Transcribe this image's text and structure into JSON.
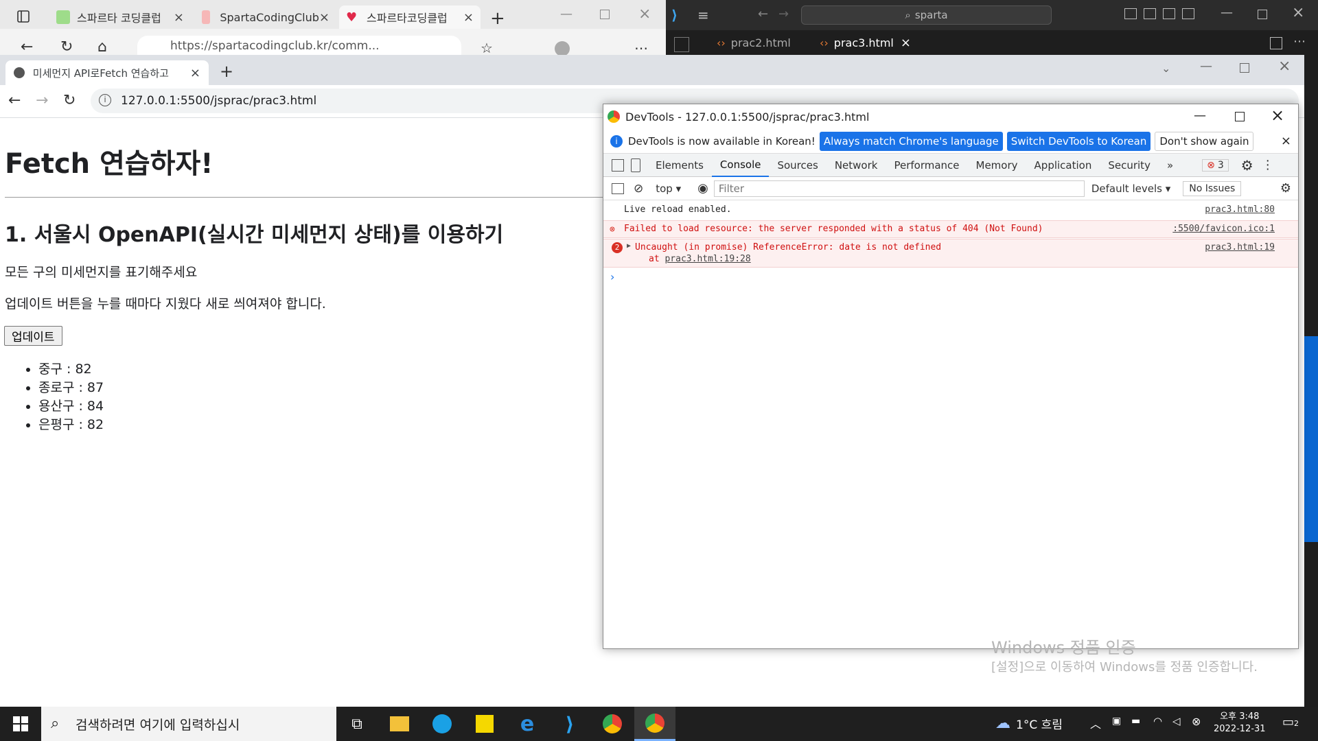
{
  "edge": {
    "tabs": [
      {
        "label": "스파르타 코딩클럽"
      },
      {
        "label": "SpartaCodingClub"
      },
      {
        "label": "스파르타코딩클럽"
      }
    ],
    "address": "https://spartacodingclub.kr/comm..."
  },
  "vscode": {
    "search": "sparta",
    "tabs": [
      {
        "label": "prac2.html"
      },
      {
        "label": "prac3.html"
      }
    ]
  },
  "chrome": {
    "tab_title": "미세먼지 API로Fetch 연습하고 ",
    "address": "127.0.0.1:5500/jsprac/prac3.html"
  },
  "page": {
    "h1": "Fetch 연습하자!",
    "h2": "1. 서울시 OpenAPI(실시간 미세먼지 상태)를 이용하기",
    "p1": "모든 구의 미세먼지를 표기해주세요",
    "p2": "업데이트 버튼을 누를 때마다 지웠다 새로 씌여져야 합니다.",
    "button": "업데이트",
    "items": [
      "중구 : 82",
      "종로구 : 87",
      "용산구 : 84",
      "은평구 : 82"
    ]
  },
  "devtools": {
    "title": "DevTools - 127.0.0.1:5500/jsprac/prac3.html",
    "info": "DevTools is now available in Korean!",
    "btn_match": "Always match Chrome's language",
    "btn_switch": "Switch DevTools to Korean",
    "btn_dont": "Don't show again",
    "tabs": [
      "Elements",
      "Console",
      "Sources",
      "Network",
      "Performance",
      "Memory",
      "Application",
      "Security"
    ],
    "more": "»",
    "error_count": "3",
    "context": "top",
    "filter_placeholder": "Filter",
    "levels": "Default levels",
    "issues": "No Issues",
    "logs": {
      "l1_text": "Live reload enabled.",
      "l1_src": "prac3.html:80",
      "l2_text": "Failed to load resource: the server responded with a status of 404 (Not Found)",
      "l2_src": ":5500/favicon.ico:1",
      "l3_count": "2",
      "l3_text": "Uncaught (in promise) ReferenceError: date is not defined",
      "l3_at": "at",
      "l3_link": "prac3.html:19:28",
      "l3_src": "prac3.html:19"
    }
  },
  "watermark": {
    "line1": "Windows 정품 인증",
    "line2": "[설정]으로 이동하여 Windows를 정품 인증합니다."
  },
  "taskbar": {
    "search": "검색하려면 여기에 입력하십시",
    "weather": "1°C 흐림",
    "time": "오후 3:48",
    "date": "2022-12-31",
    "notif": "2"
  }
}
